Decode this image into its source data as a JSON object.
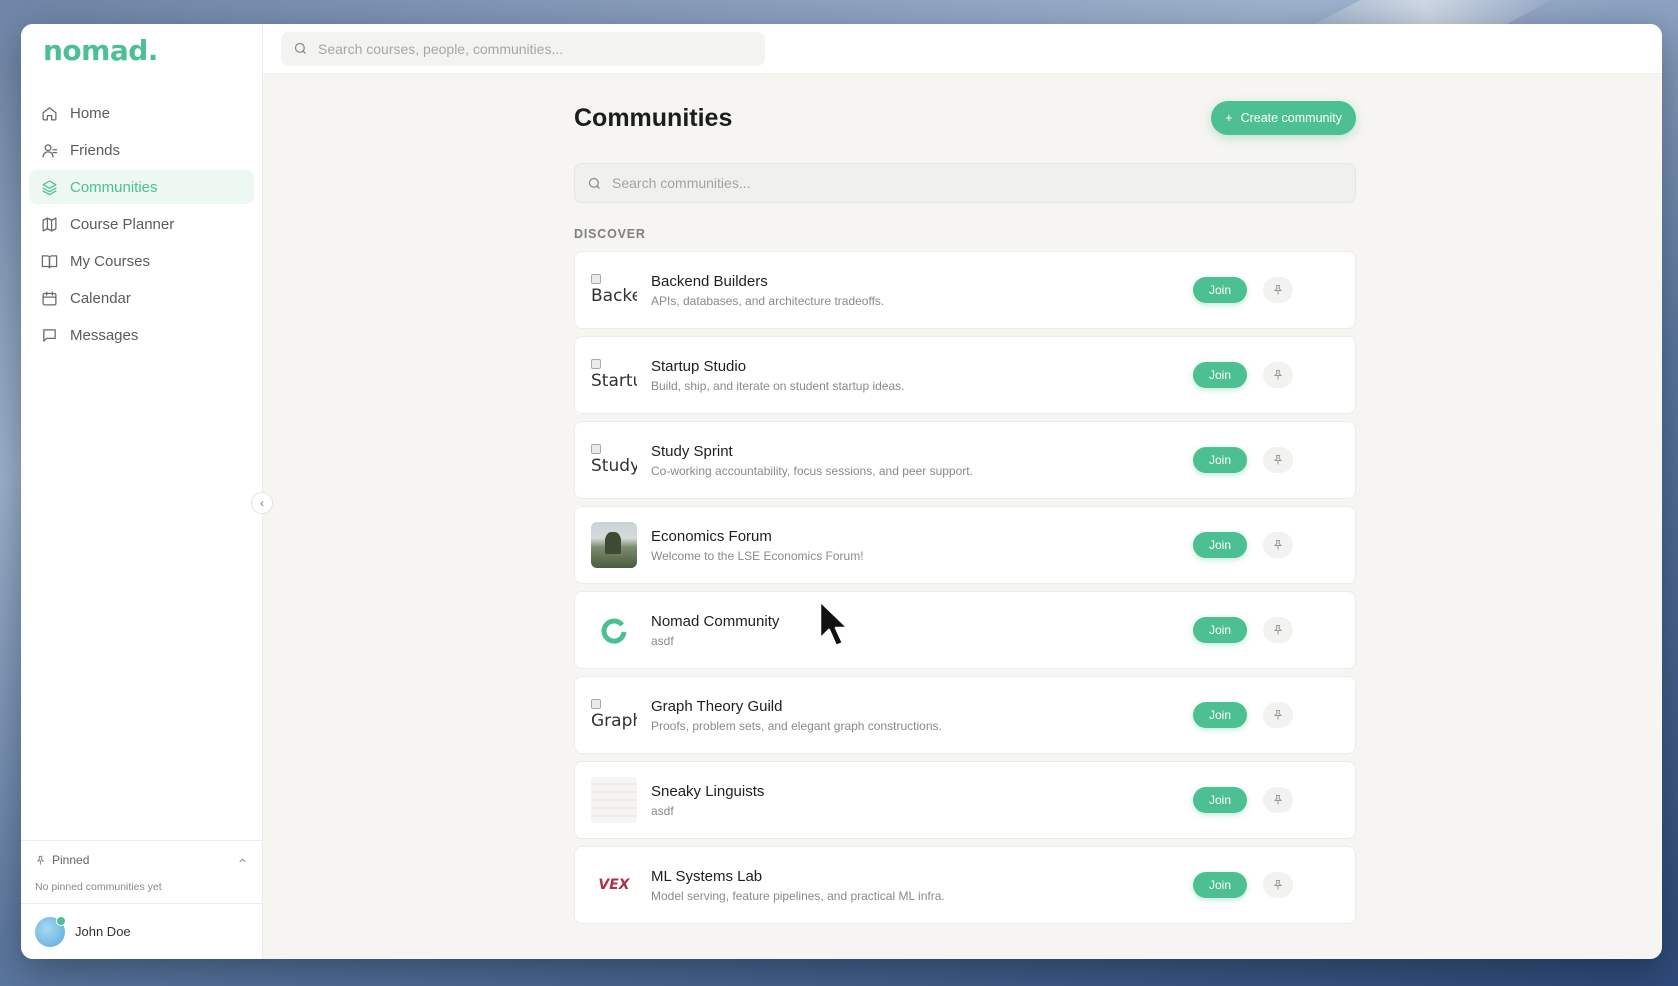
{
  "app": {
    "logo": "nomad."
  },
  "topbar": {
    "search_placeholder": "Search courses, people, communities..."
  },
  "sidebar": {
    "items": [
      {
        "label": "Home",
        "icon": "home-icon",
        "active": false
      },
      {
        "label": "Friends",
        "icon": "user-icon",
        "active": false
      },
      {
        "label": "Communities",
        "icon": "layers-icon",
        "active": true
      },
      {
        "label": "Course Planner",
        "icon": "map-icon",
        "active": false
      },
      {
        "label": "My Courses",
        "icon": "book-open-icon",
        "active": false
      },
      {
        "label": "Calendar",
        "icon": "calendar-icon",
        "active": false
      },
      {
        "label": "Messages",
        "icon": "message-icon",
        "active": false
      }
    ],
    "pinned": {
      "title": "Pinned",
      "empty": "No pinned communities yet"
    },
    "user": {
      "name": "John Doe"
    }
  },
  "main": {
    "title": "Communities",
    "create_label": "Create community",
    "search_placeholder": "Search communities...",
    "section": "DISCOVER",
    "join_label": "Join",
    "communities": [
      {
        "name": "Backend Builders",
        "desc": "APIs, databases, and architecture tradeoffs.",
        "thumb_type": "broken",
        "alt": "Backend Builders"
      },
      {
        "name": "Startup Studio",
        "desc": "Build, ship, and iterate on student startup ideas.",
        "thumb_type": "broken",
        "alt": "Startup Studio"
      },
      {
        "name": "Study Sprint",
        "desc": "Co-working accountability, focus sessions, and peer support.",
        "thumb_type": "broken",
        "alt": "Study Sprint"
      },
      {
        "name": "Economics Forum",
        "desc": "Welcome to the LSE Economics Forum!",
        "thumb_type": "photo"
      },
      {
        "name": "Nomad Community",
        "desc": "asdf",
        "thumb_type": "logo"
      },
      {
        "name": "Graph Theory Guild",
        "desc": "Proofs, problem sets, and elegant graph constructions.",
        "thumb_type": "broken",
        "alt": "Graph Theory Guild"
      },
      {
        "name": "Sneaky Linguists",
        "desc": "asdf",
        "thumb_type": "faint"
      },
      {
        "name": "ML Systems Lab",
        "desc": "Model serving, feature pipelines, and practical ML infra.",
        "thumb_type": "vex",
        "logo_text": "VEX"
      }
    ]
  },
  "colors": {
    "accent": "#4cc093",
    "active_bg": "#eef8f3"
  }
}
